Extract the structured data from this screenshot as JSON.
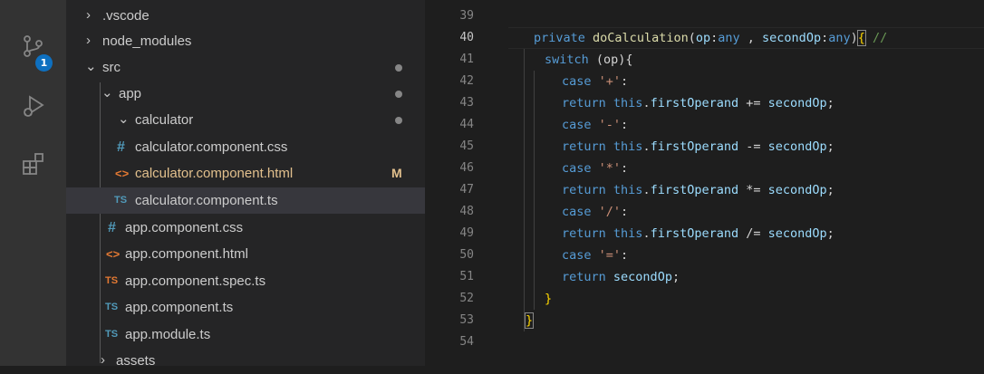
{
  "activity_bar": {
    "scm_badge": "1"
  },
  "explorer": {
    "items": [
      {
        "label": ".vscode",
        "kind": "folder",
        "expanded": false
      },
      {
        "label": "node_modules",
        "kind": "folder",
        "expanded": false
      },
      {
        "label": "src",
        "kind": "folder",
        "expanded": true
      },
      {
        "label": "app",
        "kind": "folder",
        "expanded": true
      },
      {
        "label": "calculator",
        "kind": "folder",
        "expanded": true
      },
      {
        "label": "calculator.component.css",
        "kind": "css",
        "icon": "#"
      },
      {
        "label": "calculator.component.html",
        "kind": "html",
        "icon": "<>",
        "status": "M"
      },
      {
        "label": "calculator.component.ts",
        "kind": "ts",
        "icon": "TS"
      },
      {
        "label": "app.component.css",
        "kind": "css",
        "icon": "#"
      },
      {
        "label": "app.component.html",
        "kind": "html",
        "icon": "<>"
      },
      {
        "label": "app.component.spec.ts",
        "kind": "spec",
        "icon": "TS"
      },
      {
        "label": "app.component.ts",
        "kind": "ts",
        "icon": "TS"
      },
      {
        "label": "app.module.ts",
        "kind": "ts",
        "icon": "TS"
      },
      {
        "label": "assets",
        "kind": "folder",
        "expanded": false
      }
    ]
  },
  "editor": {
    "line_numbers": [
      "39",
      "40",
      "41",
      "42",
      "43",
      "44",
      "45",
      "46",
      "47",
      "48",
      "49",
      "50",
      "51",
      "52",
      "53",
      "54"
    ],
    "active_line": "40",
    "code": {
      "l40": {
        "kw": "private",
        "fn": "doCalculation",
        "open": "(",
        "p1": "op",
        "colon1": ":",
        "t1": "any",
        "comma": " , ",
        "p2": "secondOp",
        "colon2": ":",
        "t2": "any",
        "close": ")",
        "brace": "{",
        "comment": " //"
      },
      "l41": {
        "kw": "switch",
        "rest": " (op){"
      },
      "l42": {
        "kw": "case",
        "str": "'+'",
        "colon": ":"
      },
      "l43": {
        "kw": "return",
        "this": "this",
        "dot": ".",
        "prop": "firstOperand",
        "op": " += ",
        "var": "secondOp",
        "semi": ";"
      },
      "l44": {
        "kw": "case",
        "str": "'-'",
        "colon": ":"
      },
      "l45": {
        "kw": "return",
        "this": "this",
        "dot": ".",
        "prop": "firstOperand",
        "op": " -= ",
        "var": "secondOp",
        "semi": ";"
      },
      "l46": {
        "kw": "case",
        "str": "'*'",
        "colon": ":"
      },
      "l47": {
        "kw": "return",
        "this": "this",
        "dot": ".",
        "prop": "firstOperand",
        "op": " *= ",
        "var": "secondOp",
        "semi": ";"
      },
      "l48": {
        "kw": "case",
        "str": "'/'",
        "colon": ":"
      },
      "l49": {
        "kw": "return",
        "this": "this",
        "dot": ".",
        "prop": "firstOperand",
        "op": " /= ",
        "var": "secondOp",
        "semi": ";"
      },
      "l50": {
        "kw": "case",
        "str": "'='",
        "colon": ":"
      },
      "l51": {
        "kw": "return",
        "var": "secondOp",
        "semi": ";"
      },
      "l52": {
        "text": "}"
      },
      "l53": {
        "text": "}"
      }
    }
  },
  "colors": {
    "keyword": "#569cd6",
    "function": "#dcdcaa",
    "parameter": "#9cdcfe",
    "string": "#ce9178",
    "modified": "#e2c08d",
    "badge": "#0e70c0"
  }
}
